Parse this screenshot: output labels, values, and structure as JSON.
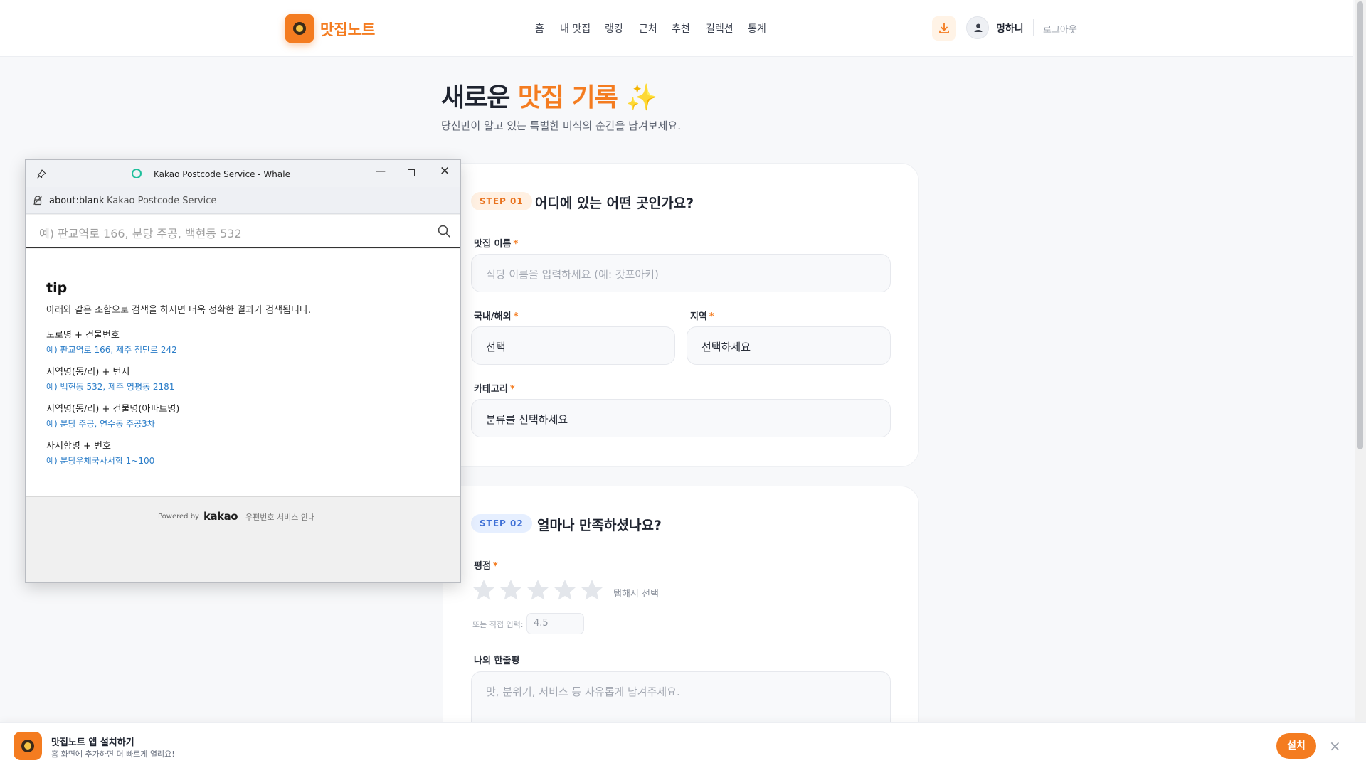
{
  "brand": {
    "name": "맛집노트",
    "accent": "#f47c20"
  },
  "nav": {
    "items": [
      "홈",
      "내 맛집",
      "랭킹",
      "근처",
      "추천",
      "컬렉션",
      "통계"
    ],
    "username": "멍하니",
    "logout": "로그아웃"
  },
  "page": {
    "title_pre": "새로운 ",
    "title_accent": "맛집 기록",
    "title_emoji": "✨",
    "subtitle": "당신만이 알고 있는 특별한 미식의 순간을 남겨보세요."
  },
  "step1": {
    "badge": "STEP 01",
    "title": "어디에 있는 어떤 곳인가요?",
    "name_label": "맛집 이름",
    "name_placeholder": "식당 이름을 입력하세요 (예: 갓포아키)",
    "domestic_label": "국내/해외",
    "domestic_value": "선택",
    "region_label": "지역",
    "region_value": "선택하세요",
    "category_label": "카테고리",
    "category_value": "분류를 선택하세요",
    "required_mark": "*"
  },
  "step2": {
    "badge": "STEP 02",
    "title": "얼마나 만족하셨나요?",
    "rating_label": "평점",
    "star_count": 5,
    "rating_value": 0,
    "tap_hint": "탭해서 선택",
    "direct_label": "또는 직접 입력:",
    "direct_placeholder": "4.5",
    "review_label": "나의 한줄평",
    "review_placeholder": "맛, 분위기, 서비스 등 자유롭게 남겨주세요."
  },
  "popup": {
    "window_title": "Kakao Postcode Service - Whale",
    "url": "about:blank",
    "page_title": "Kakao Postcode Service",
    "search_placeholder": "예) 판교역로 166, 분당 주공, 백현동 532",
    "tip_title": "tip",
    "tip_desc": "아래와 같은 조합으로 검색을 하시면 더욱 정확한 결과가 검색됩니다.",
    "tips": [
      {
        "head": "도로명 + 건물번호",
        "example": "예) 판교역로 166,  제주 첨단로 242"
      },
      {
        "head": "지역명(동/리) + 번지",
        "example": "예) 백현동 532,  제주 영평동 2181"
      },
      {
        "head": "지역명(동/리) + 건물명(아파트명)",
        "example": "예) 분당 주공,  연수동 주공3차"
      },
      {
        "head": "사서함명 + 번호",
        "example": "예) 분당우체국사서함 1~100"
      }
    ],
    "powered_by": "Powered by",
    "kakao": "kakao",
    "service_link": "우편번호 서비스 안내"
  },
  "install_banner": {
    "title": "맛집노트 앱 설치하기",
    "subtitle": "홈 화면에 추가하면 더 빠르게 열려요!",
    "install_label": "설치",
    "close_icon": "×"
  },
  "icons": {
    "download": "download-icon",
    "user": "user-icon",
    "search": "search-icon",
    "pin": "pin-icon",
    "star": "star-icon"
  }
}
